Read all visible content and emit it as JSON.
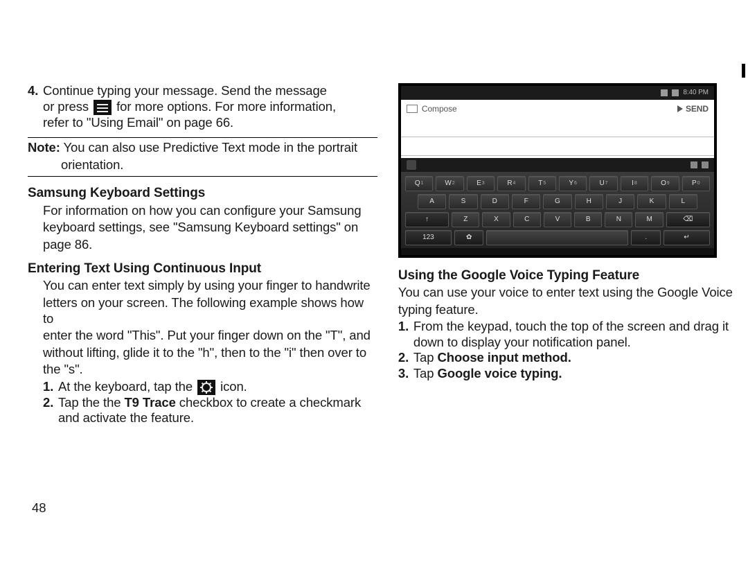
{
  "left": {
    "step4_line1": "Continue typing your message. Send the message",
    "step4_line2a": "or press ",
    "step4_line2b": " for more options. For more information,",
    "step4_line3": "refer to \"Using Email\" on page 66.",
    "step4_num": "4.",
    "note_label": "Note:",
    "note_line1": " You can also use Predictive Text mode in the portrait",
    "note_line2": "orientation.",
    "h_samsung": "Samsung Keyboard Settings",
    "samsung_p1": "For information on how you can configure your Samsung",
    "samsung_p2": "keyboard settings, see \"Samsung Keyboard settings\" on",
    "samsung_p3": "page 86.",
    "h_continuous": "Entering Text Using Continuous Input",
    "cont_p1": "You can enter text simply by using your finger to handwrite",
    "cont_p2": "letters on your screen. The following example shows how to",
    "cont_p3": "enter the word \"This\". Put your finger down on the \"T\", and",
    "cont_p4": "without lifting, glide it to the \"h\", then to the \"i\" then over to",
    "cont_p5": "the \"s\".",
    "cont_s1_num": "1.",
    "cont_s1a": "At the keyboard, tap the ",
    "cont_s1b": " icon.",
    "cont_s2_num": "2.",
    "cont_s2a": "Tap the the ",
    "cont_s2_bold": "T9 Trace",
    "cont_s2b": " checkbox to create a checkmark",
    "cont_s2c": "and activate the feature."
  },
  "right": {
    "h_voice": "Using the Google Voice Typing Feature",
    "voice_p1": "You can use your voice to enter text using the Google Voice",
    "voice_p2": "typing feature.",
    "voice_s1_num": "1.",
    "voice_s1a": "From the keypad, touch the top of the screen and drag it",
    "voice_s1b": "down to display your notification panel.",
    "voice_s2_num": "2.",
    "voice_s2a": "Tap ",
    "voice_s2_bold": "Choose input method.",
    "voice_s3_num": "3.",
    "voice_s3a": "Tap ",
    "voice_s3_bold": "Google voice typing."
  },
  "screenshot": {
    "compose_label": "Compose",
    "send_label": "SEND",
    "status_time": "8:40 PM",
    "row1": [
      "Q",
      "W",
      "E",
      "R",
      "T",
      "Y",
      "U",
      "I",
      "O",
      "P"
    ],
    "row1_sup": [
      "1",
      "2",
      "3",
      "4",
      "5",
      "6",
      "7",
      "8",
      "9",
      "0"
    ],
    "row2": [
      "A",
      "S",
      "D",
      "F",
      "G",
      "H",
      "J",
      "K",
      "L"
    ],
    "row3_shift": "↑",
    "row3": [
      "Z",
      "X",
      "C",
      "V",
      "B",
      "N",
      "M"
    ],
    "row3_del": "⌫",
    "row4_sym": "123",
    "row4_gear": "✿",
    "row4_dot": ".",
    "row4_enter": "↵"
  },
  "page_number": "48"
}
